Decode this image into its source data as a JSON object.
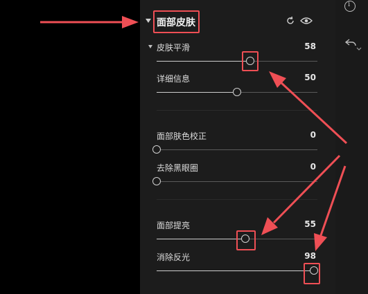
{
  "section": {
    "title": "面部皮肤"
  },
  "subsection": {
    "title": "皮肤平滑"
  },
  "sliders": [
    {
      "label": "皮肤平滑",
      "value": "58",
      "level": 58
    },
    {
      "label": "详细信息",
      "value": "50",
      "level": 50
    },
    {
      "label": "面部肤色校正",
      "value": "0",
      "level": 0
    },
    {
      "label": "去除黑眼圈",
      "value": "0",
      "level": 0
    },
    {
      "label": "面部提亮",
      "value": "55",
      "level": 55
    },
    {
      "label": "消除反光",
      "value": "98",
      "level": 98
    }
  ],
  "icons": {
    "reset": "reset-icon",
    "visibility": "eye-icon",
    "info": "info-icon",
    "undo": "undo-icon"
  },
  "colors": {
    "annotation": "#ef4f55",
    "panel": "#1c1c1c"
  }
}
